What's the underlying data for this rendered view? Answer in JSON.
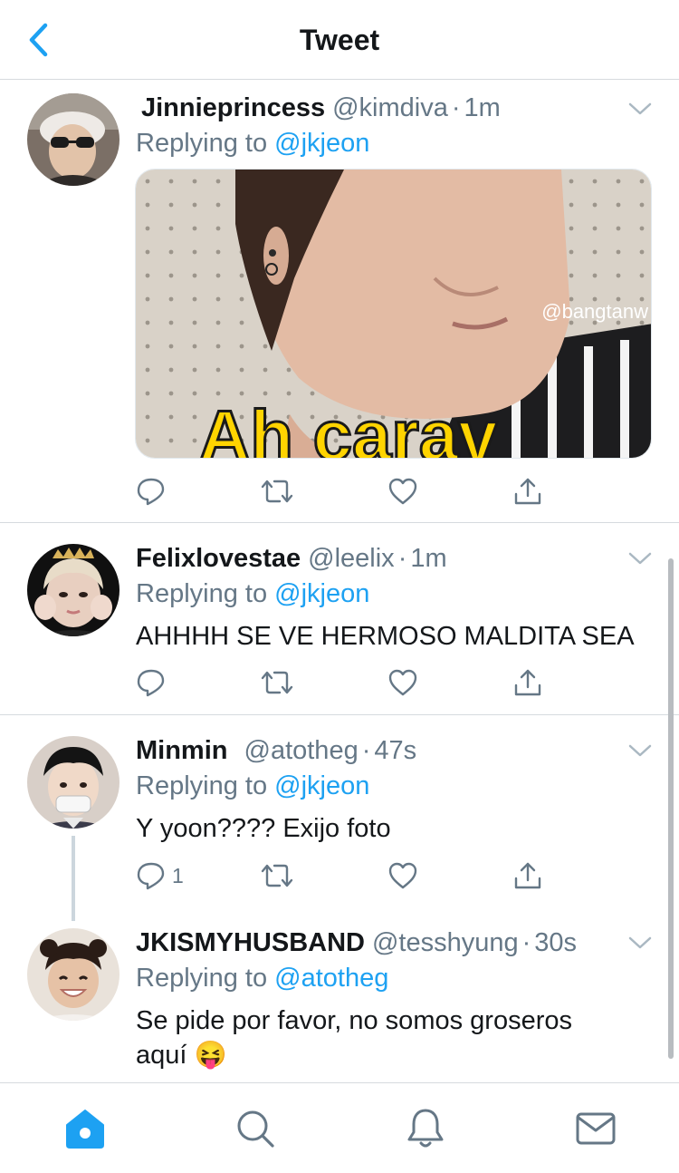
{
  "header": {
    "title": "Tweet"
  },
  "tweets": [
    {
      "name": "Jinnieprincess",
      "handle": "@kimdiva",
      "sep": "·",
      "time": "1m",
      "replying_prefix": "Replying to ",
      "replying_to": "@jkjeon",
      "media": {
        "watermark": "@bangtanw",
        "caption": "Ah carav"
      }
    },
    {
      "name": "Felixlovestae",
      "handle": "@leelix",
      "sep": "·",
      "time": "1m",
      "replying_prefix": "Replying to ",
      "replying_to": "@jkjeon",
      "text": "AHHHH SE VE HERMOSO MALDITA SEA"
    },
    {
      "name": "Minmin",
      "handle": "@atotheg",
      "sep": "·",
      "time": "47s",
      "replying_prefix": "Replying to ",
      "replying_to": "@jkjeon",
      "text": "Y yoon???? Exijo foto",
      "reply_count": "1"
    },
    {
      "name": "JKISMYHUSBAND",
      "handle": "@tesshyung",
      "sep": "·",
      "time": "30s",
      "replying_prefix": "Replying to ",
      "replying_to": "@atotheg",
      "text_line1": "Se pide por favor, no somos groseros",
      "text_line2": "aquí 😝"
    }
  ],
  "icons": {
    "back": "chevron-left-icon",
    "caret": "chevron-down-icon",
    "reply": "reply-icon",
    "retweet": "retweet-icon",
    "like": "heart-icon",
    "share": "share-icon",
    "home": "home-icon",
    "search": "search-icon",
    "notifications": "bell-icon",
    "messages": "mail-icon"
  },
  "colors": {
    "accent": "#1da1f2",
    "text": "#14171a",
    "secondary": "#657786",
    "divider": "#d6dade"
  }
}
